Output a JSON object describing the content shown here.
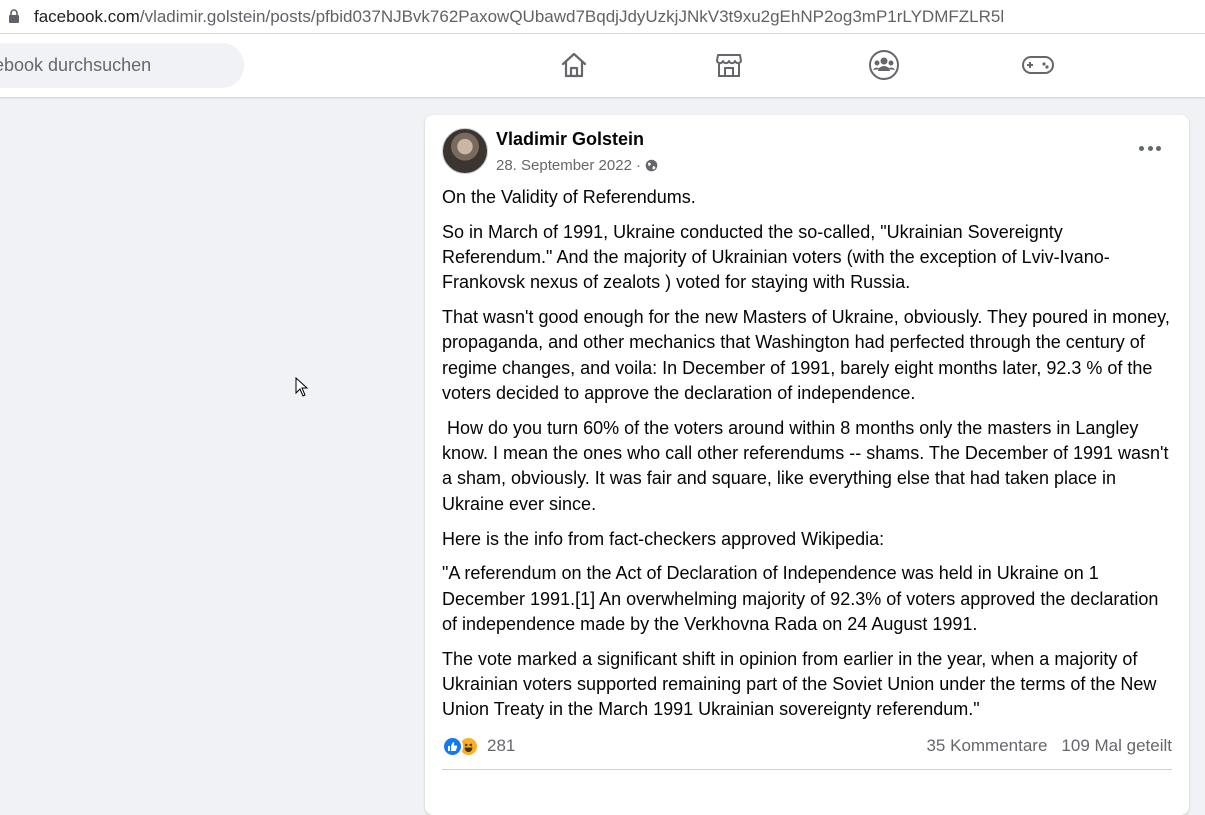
{
  "browser": {
    "url_domain": "facebook.com",
    "url_path": "/vladimir.golstein/posts/pfbid037NJBvk762PaxowQUbawd7BqdjJdyUzkjJNkV3t9xu2gEhNP2og3mP1rLYDMFZLR5l"
  },
  "topnav": {
    "search_placeholder": "ebook durchsuchen",
    "icons": [
      "home-icon",
      "marketplace-icon",
      "groups-icon",
      "gaming-icon"
    ]
  },
  "post": {
    "author": "Vladimir Golstein",
    "date": "28. September 2022",
    "separator": "·",
    "paragraphs": [
      "On the Validity of Referendums.",
      "So in March of 1991, Ukraine conducted the so-called, \"Ukrainian Sovereignty Referendum.\" And the majority of Ukrainian voters (with the exception of Lviv-Ivano-Frankovsk nexus of zealots ) voted for staying with Russia.",
      "That wasn't good enough for the new Masters of Ukraine, obviously. They poured in money, propaganda, and other mechanics that Washington had perfected through the century of regime changes, and voila: In December of 1991, barely eight months later, 92.3 % of the voters decided to approve the declaration of independence.",
      " How do you turn 60% of the voters around within 8 months only the masters in Langley know. I mean the ones who call other referendums -- shams. The December of 1991 wasn't a sham, obviously. It was fair and square, like everything else that had taken place in Ukraine ever since.",
      "Here is the info from fact-checkers approved Wikipedia:",
      "\"A referendum on the Act of Declaration of Independence was held in Ukraine on 1 December 1991.[1] An overwhelming majority of 92.3% of voters approved the declaration of independence made by the Verkhovna Rada on 24 August 1991.",
      "The vote marked a significant shift in opinion from earlier in the year, when a majority of Ukrainian voters supported remaining part of the Soviet Union under the terms of the New Union Treaty in the March 1991 Ukrainian sovereignty referendum.\""
    ],
    "reaction_count": "281",
    "comments": "35 Kommentare",
    "shares": "109 Mal geteilt"
  },
  "colors": {
    "fb_blue": "#1877f2",
    "background": "#f0f2f5",
    "secondary_text": "#65676b"
  }
}
